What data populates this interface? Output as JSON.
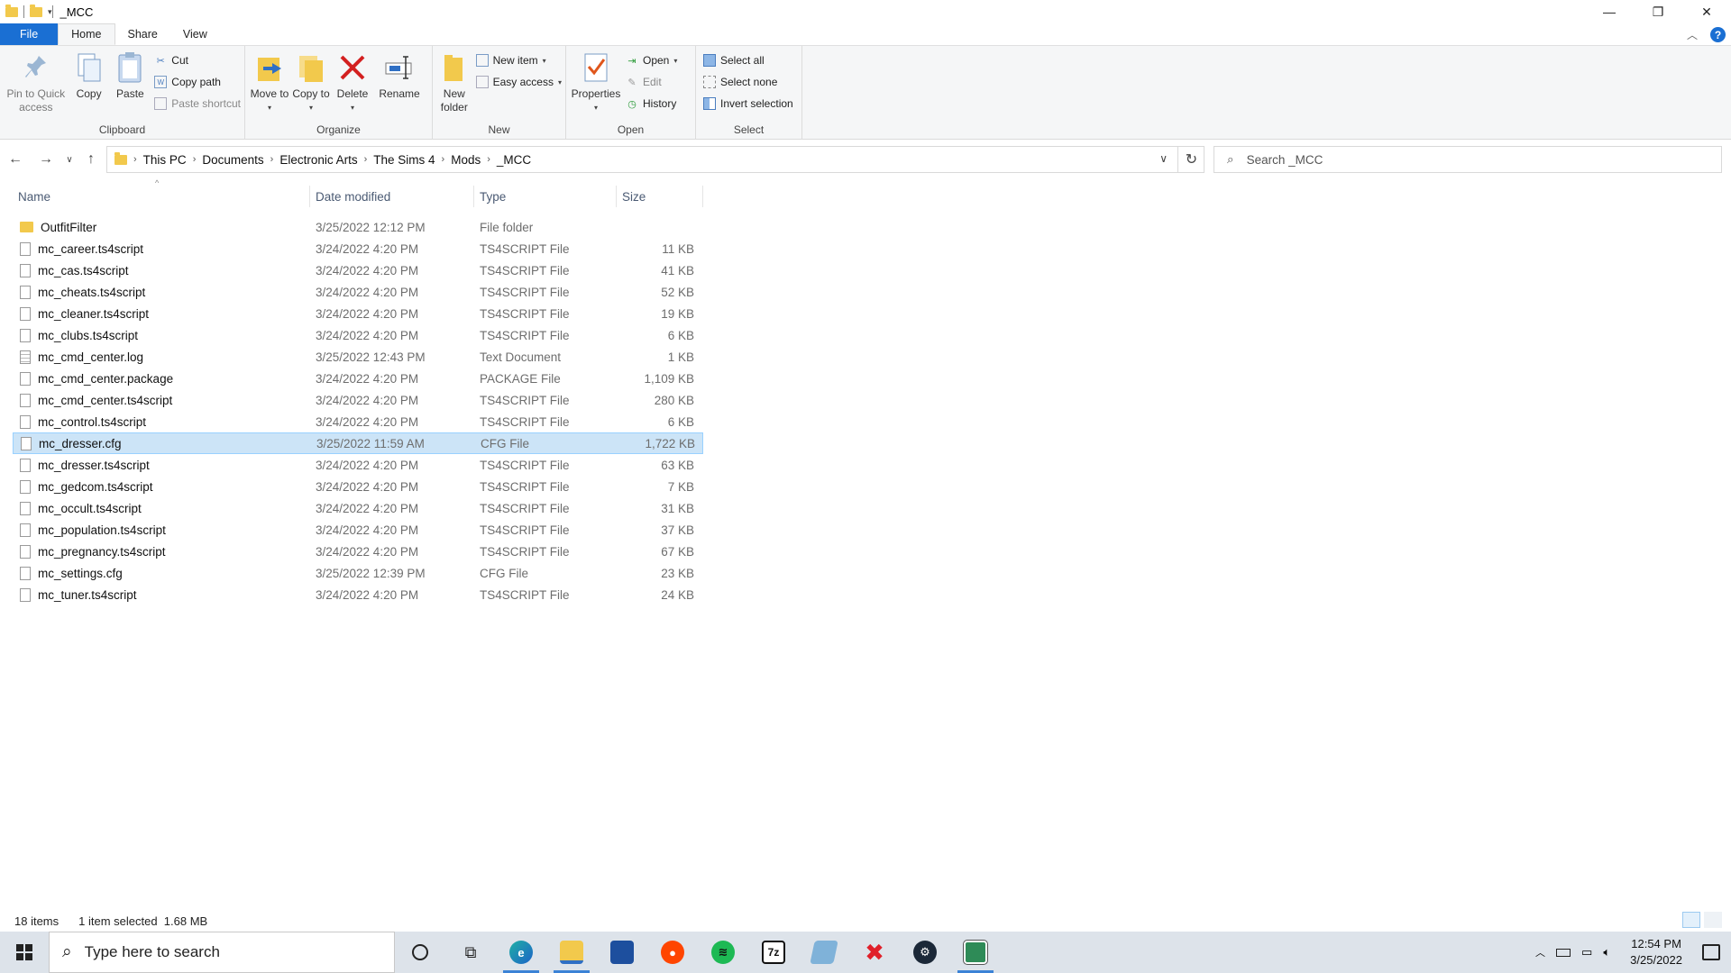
{
  "window": {
    "title": "_MCC",
    "controls": {
      "minimize": "—",
      "maximize": "❐",
      "close": "✕"
    }
  },
  "ribbon_tabs": [
    {
      "label": "File"
    },
    {
      "label": "Home"
    },
    {
      "label": "Share"
    },
    {
      "label": "View"
    }
  ],
  "ribbon": {
    "clipboard": {
      "label": "Clipboard",
      "pin": "Pin to Quick access",
      "copy": "Copy",
      "paste": "Paste",
      "cut": "Cut",
      "copy_path": "Copy path",
      "paste_shortcut": "Paste shortcut"
    },
    "organize": {
      "label": "Organize",
      "move_to": "Move to",
      "copy_to": "Copy to",
      "delete": "Delete",
      "rename": "Rename"
    },
    "new": {
      "label": "New",
      "new_folder": "New folder",
      "new_item": "New item",
      "easy_access": "Easy access"
    },
    "open": {
      "label": "Open",
      "properties": "Properties",
      "open": "Open",
      "edit": "Edit",
      "history": "History"
    },
    "select": {
      "label": "Select",
      "select_all": "Select all",
      "select_none": "Select none",
      "invert": "Invert selection"
    }
  },
  "address": {
    "crumbs": [
      "This PC",
      "Documents",
      "Electronic Arts",
      "The Sims 4",
      "Mods",
      "_MCC"
    ],
    "search_placeholder": "Search _MCC"
  },
  "columns": {
    "name": "Name",
    "date": "Date modified",
    "type": "Type",
    "size": "Size"
  },
  "files": [
    {
      "name": "OutfitFilter",
      "date": "3/25/2022 12:12 PM",
      "type": "File folder",
      "size": "",
      "icon": "folder-icon"
    },
    {
      "name": "mc_career.ts4script",
      "date": "3/24/2022 4:20 PM",
      "type": "TS4SCRIPT File",
      "size": "11 KB",
      "icon": "file-icon"
    },
    {
      "name": "mc_cas.ts4script",
      "date": "3/24/2022 4:20 PM",
      "type": "TS4SCRIPT File",
      "size": "41 KB",
      "icon": "file-icon"
    },
    {
      "name": "mc_cheats.ts4script",
      "date": "3/24/2022 4:20 PM",
      "type": "TS4SCRIPT File",
      "size": "52 KB",
      "icon": "file-icon"
    },
    {
      "name": "mc_cleaner.ts4script",
      "date": "3/24/2022 4:20 PM",
      "type": "TS4SCRIPT File",
      "size": "19 KB",
      "icon": "file-icon"
    },
    {
      "name": "mc_clubs.ts4script",
      "date": "3/24/2022 4:20 PM",
      "type": "TS4SCRIPT File",
      "size": "6 KB",
      "icon": "file-icon"
    },
    {
      "name": "mc_cmd_center.log",
      "date": "3/25/2022 12:43 PM",
      "type": "Text Document",
      "size": "1 KB",
      "icon": "text-document-icon"
    },
    {
      "name": "mc_cmd_center.package",
      "date": "3/24/2022 4:20 PM",
      "type": "PACKAGE File",
      "size": "1,109 KB",
      "icon": "file-icon"
    },
    {
      "name": "mc_cmd_center.ts4script",
      "date": "3/24/2022 4:20 PM",
      "type": "TS4SCRIPT File",
      "size": "280 KB",
      "icon": "file-icon"
    },
    {
      "name": "mc_control.ts4script",
      "date": "3/24/2022 4:20 PM",
      "type": "TS4SCRIPT File",
      "size": "6 KB",
      "icon": "file-icon"
    },
    {
      "name": "mc_dresser.cfg",
      "date": "3/25/2022 11:59 AM",
      "type": "CFG File",
      "size": "1,722 KB",
      "icon": "file-icon",
      "selected": true
    },
    {
      "name": "mc_dresser.ts4script",
      "date": "3/24/2022 4:20 PM",
      "type": "TS4SCRIPT File",
      "size": "63 KB",
      "icon": "file-icon"
    },
    {
      "name": "mc_gedcom.ts4script",
      "date": "3/24/2022 4:20 PM",
      "type": "TS4SCRIPT File",
      "size": "7 KB",
      "icon": "file-icon"
    },
    {
      "name": "mc_occult.ts4script",
      "date": "3/24/2022 4:20 PM",
      "type": "TS4SCRIPT File",
      "size": "31 KB",
      "icon": "file-icon"
    },
    {
      "name": "mc_population.ts4script",
      "date": "3/24/2022 4:20 PM",
      "type": "TS4SCRIPT File",
      "size": "37 KB",
      "icon": "file-icon"
    },
    {
      "name": "mc_pregnancy.ts4script",
      "date": "3/24/2022 4:20 PM",
      "type": "TS4SCRIPT File",
      "size": "67 KB",
      "icon": "file-icon"
    },
    {
      "name": "mc_settings.cfg",
      "date": "3/25/2022 12:39 PM",
      "type": "CFG File",
      "size": "23 KB",
      "icon": "file-icon"
    },
    {
      "name": "mc_tuner.ts4script",
      "date": "3/24/2022 4:20 PM",
      "type": "TS4SCRIPT File",
      "size": "24 KB",
      "icon": "file-icon"
    }
  ],
  "status": {
    "count": "18 items",
    "selection": "1 item selected  1.68 MB"
  },
  "taskbar": {
    "search_placeholder": "Type here to search",
    "time": "12:54 PM",
    "date": "3/25/2022",
    "apps": [
      {
        "name": "cortana-icon"
      },
      {
        "name": "task-view-icon"
      },
      {
        "name": "edge-icon",
        "running": true
      },
      {
        "name": "file-explorer-icon",
        "running": true
      },
      {
        "name": "microsoft-store-icon"
      },
      {
        "name": "reddit-icon"
      },
      {
        "name": "spotify-icon"
      },
      {
        "name": "7zip-icon",
        "label": "7z"
      },
      {
        "name": "notepad-app-icon"
      },
      {
        "name": "xmind-icon"
      },
      {
        "name": "steam-icon"
      },
      {
        "name": "sims4-studio-icon",
        "running": true
      }
    ]
  },
  "colors": {
    "accent": "#1a6fd3",
    "selection_bg": "#cce4f7",
    "selection_border": "#99d1ff",
    "folder": "#f2c94c"
  }
}
